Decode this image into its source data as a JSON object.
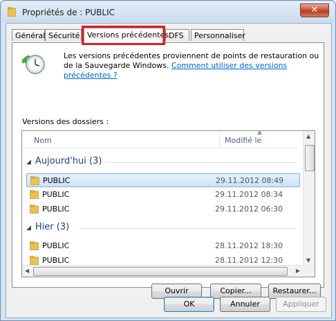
{
  "window": {
    "title": "Propriétés de : PUBLIC",
    "close_glyph": "✕"
  },
  "tabs": [
    {
      "label": "Général"
    },
    {
      "label": "Sécurité"
    },
    {
      "label": "Versions précédentes"
    },
    {
      "label": "DFS"
    },
    {
      "label": "Personnaliser"
    }
  ],
  "description": {
    "text": "Les versions précédentes proviennent de points de restauration ou de la Sauvegarde Windows.",
    "link": "Comment utiliser des versions précédentes ?"
  },
  "versions_label": "Versions des dossiers :",
  "columns": {
    "name": "Nom",
    "modified": "Modifié le"
  },
  "groups": [
    {
      "label": "Aujourd'hui (3)",
      "rows": [
        {
          "name": "PUBLIC",
          "date": "29.11.2012 08:49",
          "selected": true
        },
        {
          "name": "PUBLIC",
          "date": "29.11.2012 08:34"
        },
        {
          "name": "PUBLIC",
          "date": "29.11.2012 06:30"
        }
      ]
    },
    {
      "label": "Hier (3)",
      "rows": [
        {
          "name": "PUBLIC",
          "date": "28.11.2012 18:30"
        },
        {
          "name": "PUBLIC",
          "date": "28.11.2012 12:30"
        }
      ]
    }
  ],
  "actions": {
    "open": "Ouvrir",
    "copy": "Copier...",
    "restore": "Restaurer..."
  },
  "footer": {
    "ok": "OK",
    "cancel": "Annuler",
    "apply": "Appliquer"
  },
  "colors": {
    "highlight_border": "#e02020",
    "link": "#0066cc",
    "group_text": "#1e3f8a"
  }
}
